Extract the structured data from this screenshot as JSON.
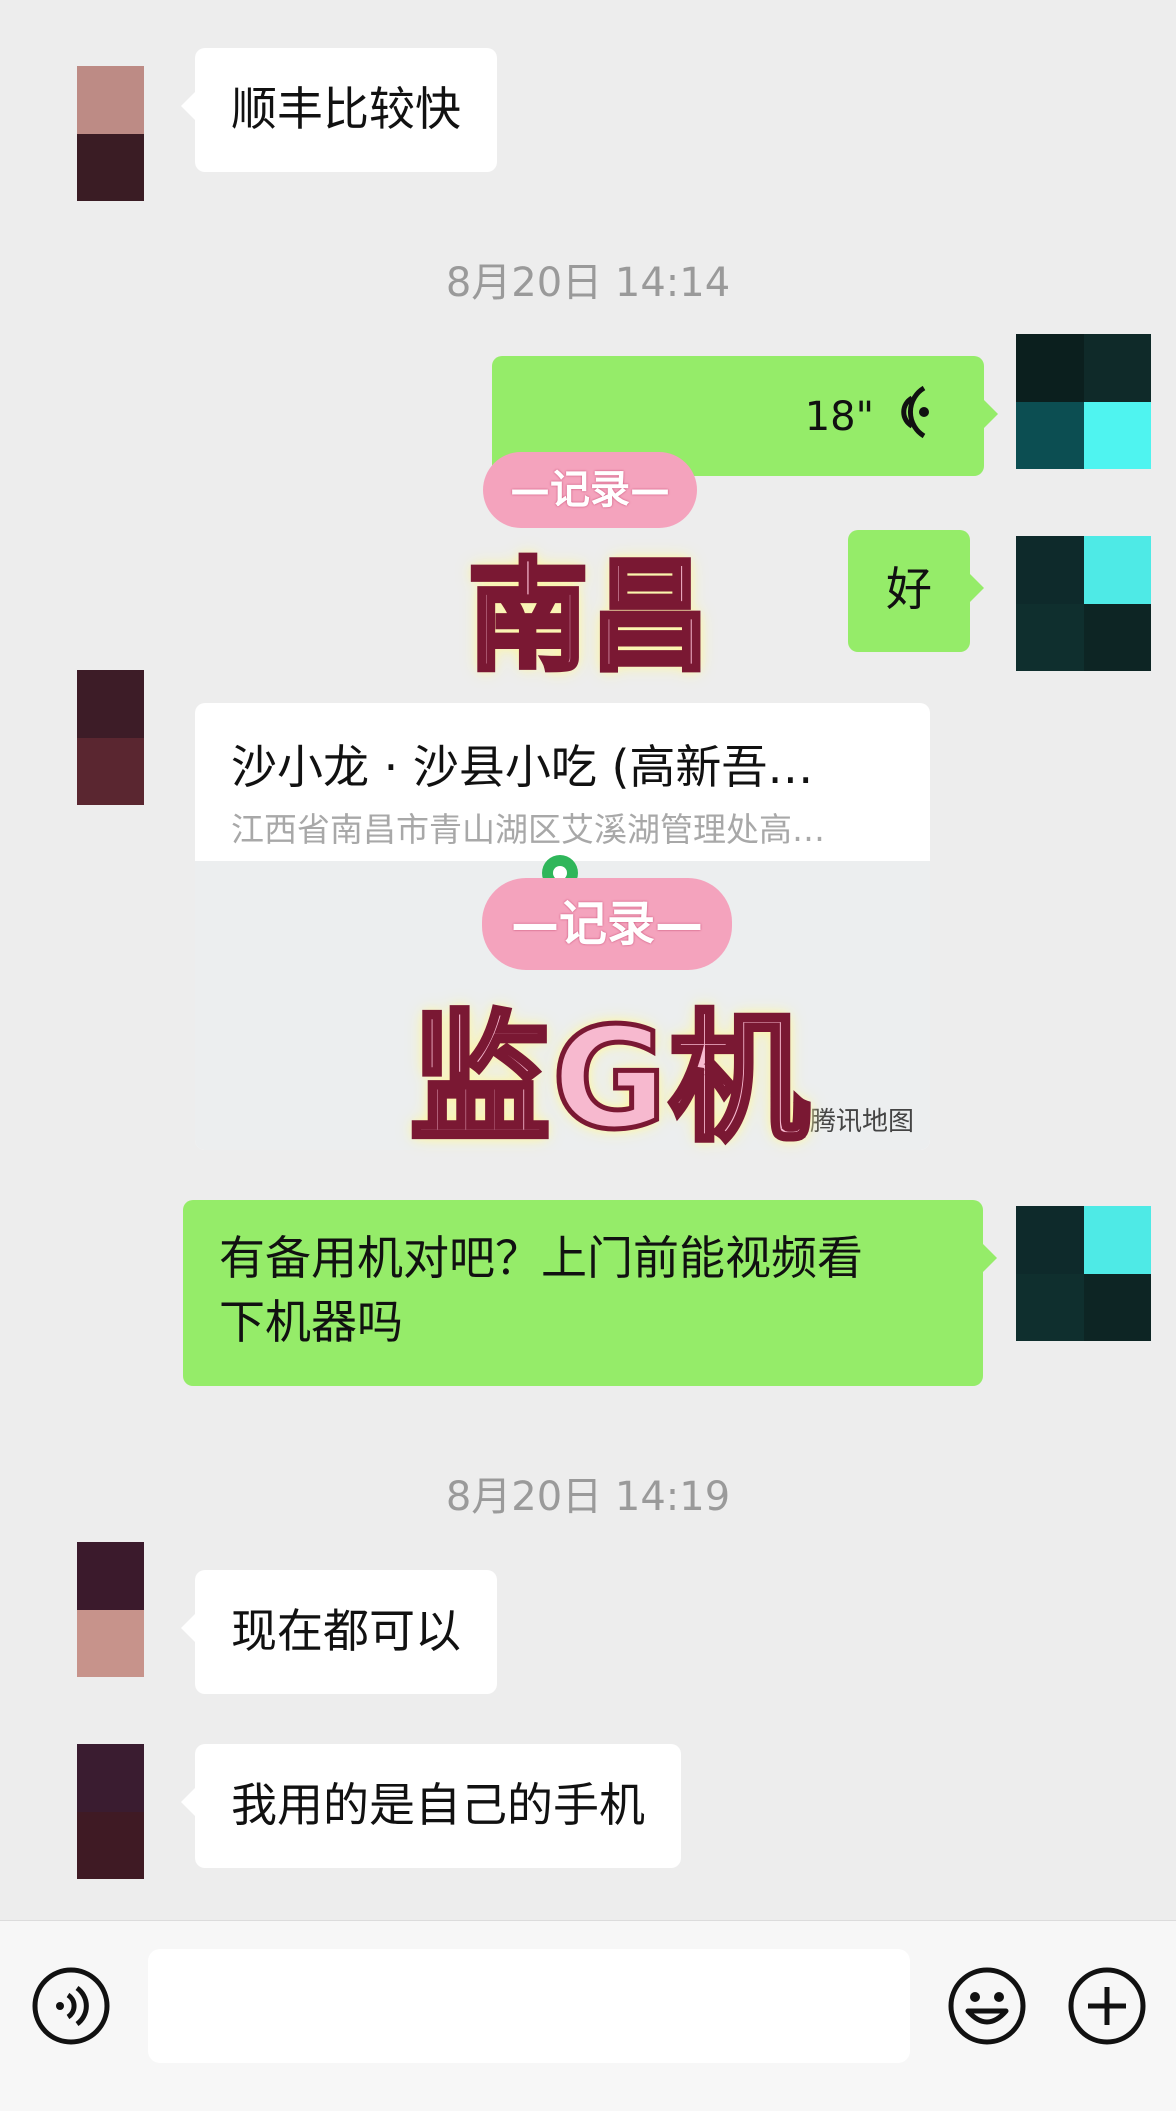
{
  "messages": {
    "m1": "顺丰比较快",
    "t1": "8月20日 14:14",
    "voice_duration": "18\"",
    "m3": "好",
    "location_title": "沙小龙 · 沙县小吃 (高新吾…",
    "location_address": "江西省南昌市青山湖区艾溪湖管理处高…",
    "map_credit": "腾讯地图",
    "m5": "有备用机对吧？上门前能视频看",
    "m5b": "下机器吗",
    "t2": "8月20日 14:19",
    "m6": "现在都可以",
    "m7": "我用的是自己的手机"
  },
  "watermarks": {
    "tag": "—记录—",
    "word1": "南昌",
    "word2": "监G机"
  },
  "colors": {
    "background": "#ededed",
    "my_bubble": "#95ec69",
    "their_bubble": "#ffffff"
  },
  "icons": {
    "voice_message": "voice-wave-icon",
    "voice_input": "voice-input-icon",
    "emoji": "emoji-icon",
    "more": "plus-icon"
  }
}
